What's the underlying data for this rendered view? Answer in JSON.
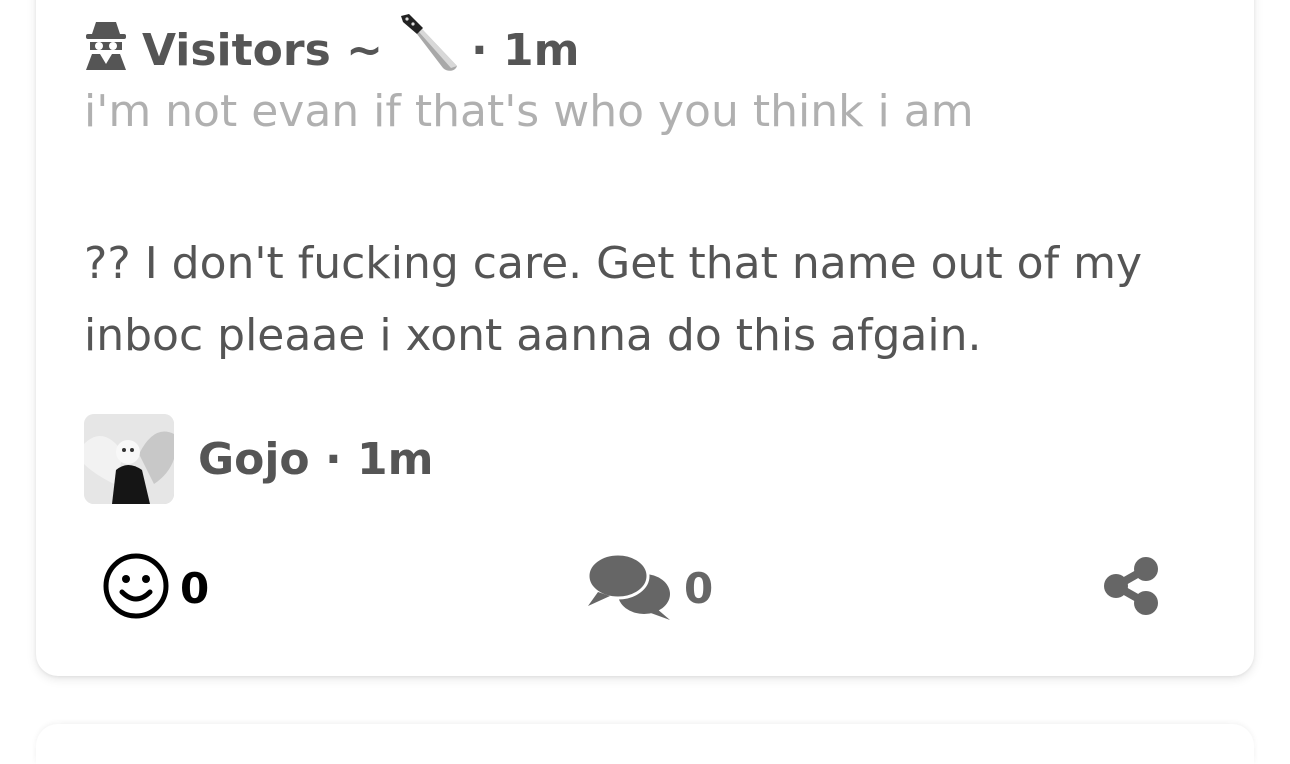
{
  "post": {
    "author": "Visitors ~",
    "time": "· 1m",
    "subtitle": "i'm not evan if that's who you think i am"
  },
  "reply": {
    "message": "?? I don't fucking care. Get that name out of my inboc pleaae i xont aanna do this afgain.",
    "author": "Gojo · 1m"
  },
  "actions": {
    "reactions_count": "0",
    "comments_count": "0"
  },
  "icons": {
    "spy": "detective-icon",
    "knife": "knife-emoji-icon",
    "reaction": "smiley-icon",
    "comment": "comments-icon",
    "share": "share-icon"
  },
  "colors": {
    "text": "#555555",
    "subtitle": "#b0b0b0",
    "icon_dark": "#000000",
    "icon_gray": "#666666"
  }
}
